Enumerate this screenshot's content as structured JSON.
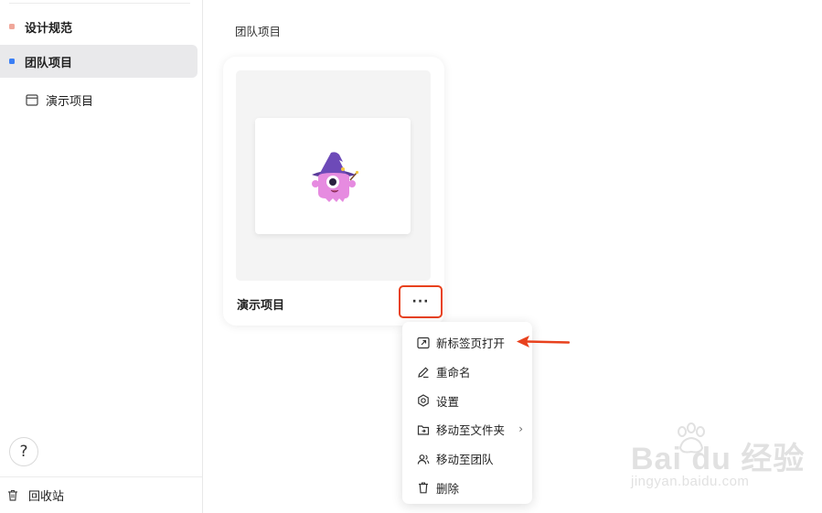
{
  "sidebar": {
    "items": [
      {
        "label": "设计规范",
        "dot_color": "#f0a79a"
      },
      {
        "label": "团队项目",
        "dot_color": "#3b7ff5",
        "active": true
      }
    ],
    "subitem": {
      "label": "演示项目",
      "icon": "window-icon"
    },
    "help_label": "?",
    "trash_label": "回收站"
  },
  "main": {
    "section_title": "团队项目",
    "card": {
      "title": "演示项目",
      "more_label": "···"
    }
  },
  "context_menu": {
    "items": [
      {
        "label": "新标签页打开",
        "icon": "open-new-tab-icon"
      },
      {
        "label": "重命名",
        "icon": "pencil-icon"
      },
      {
        "label": "设置",
        "icon": "settings-icon"
      },
      {
        "label": "移动至文件夹",
        "icon": "folder-move-icon",
        "submenu": true
      },
      {
        "label": "移动至团队",
        "icon": "team-icon"
      },
      {
        "label": "删除",
        "icon": "trash-icon"
      }
    ],
    "submenu_chevron": "›"
  },
  "annotation": {
    "color": "#e8411d"
  },
  "watermark": {
    "main": "Bai du 经验",
    "sub": "jingyan.baidu.com"
  }
}
